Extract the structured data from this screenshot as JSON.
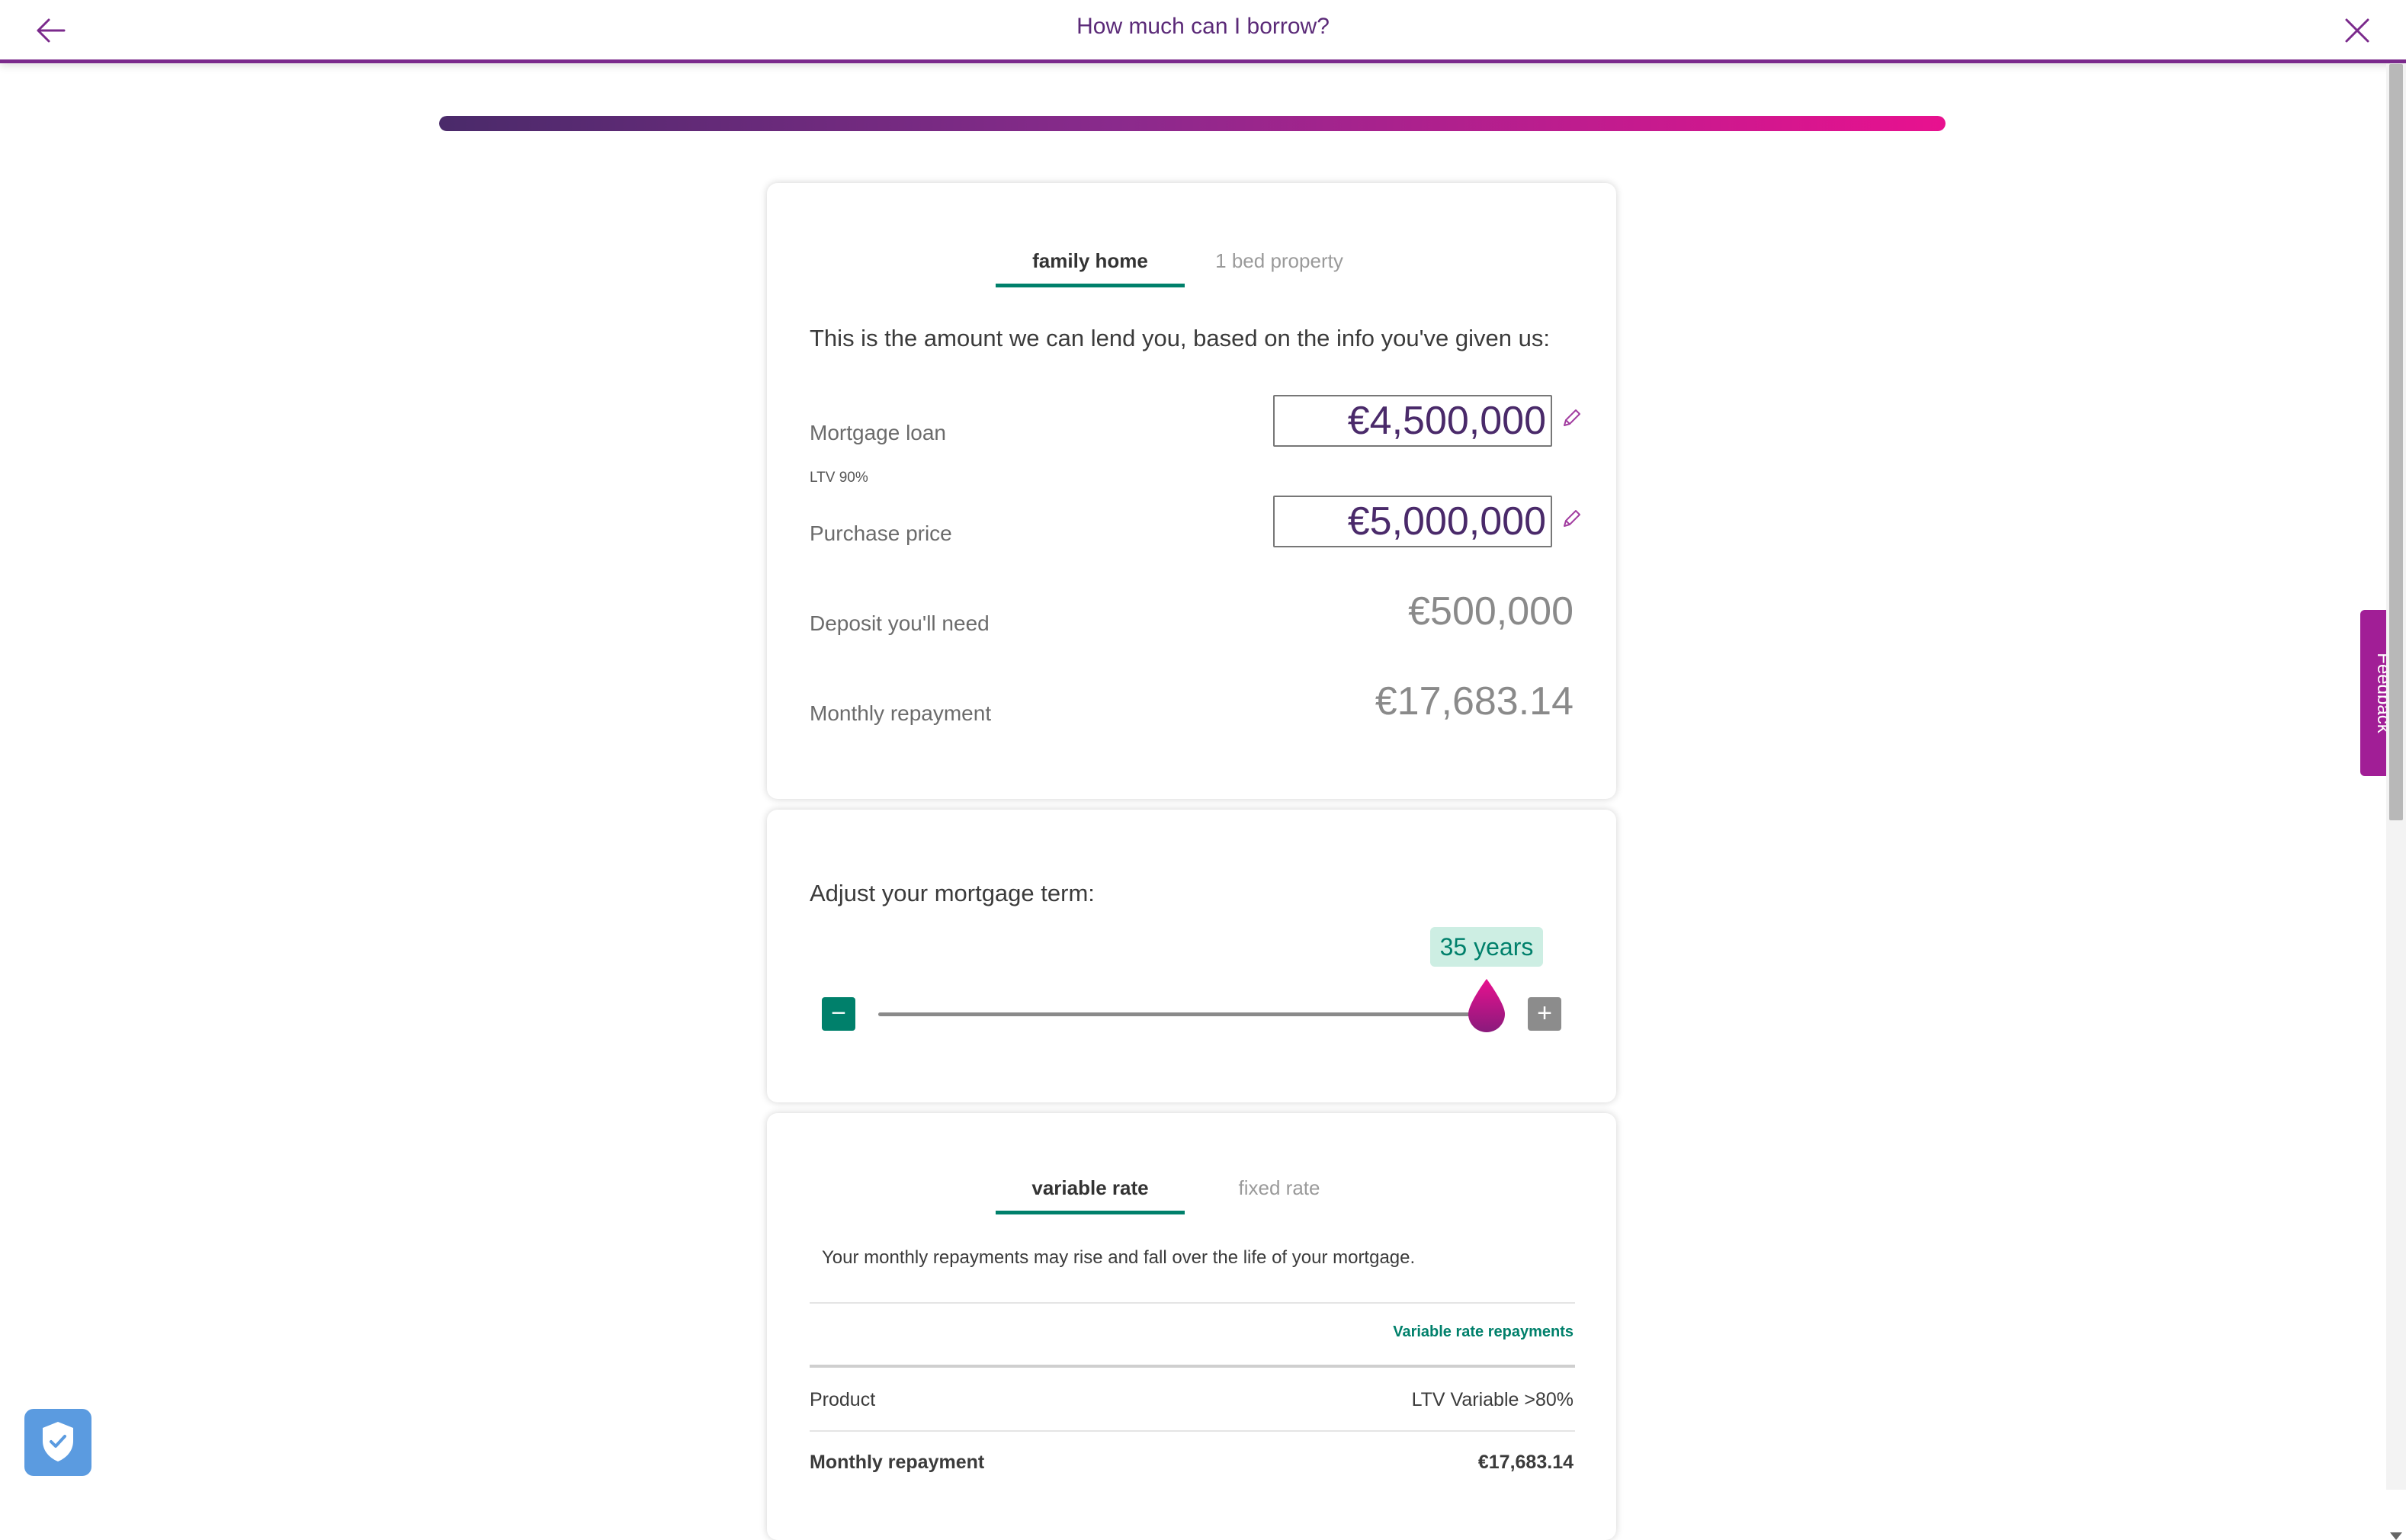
{
  "header": {
    "title": "How much can I borrow?",
    "back_icon": "arrow-left-icon",
    "close_icon": "close-icon",
    "accent": "#7b2a8c"
  },
  "progress": {
    "fraction": 1.0
  },
  "summary_card": {
    "tabs": [
      {
        "label": "family home",
        "active": true
      },
      {
        "label": "1 bed property",
        "active": false
      }
    ],
    "intro": "This is the amount we can lend you, based on the info you've given us:",
    "mortgage_loan": {
      "label": "Mortgage loan",
      "value": "€4,500,000"
    },
    "ltv": "LTV 90%",
    "purchase_price": {
      "label": "Purchase price",
      "value": "€5,000,000"
    },
    "deposit": {
      "label": "Deposit you'll need",
      "value": "€500,000"
    },
    "monthly": {
      "label": "Monthly repayment",
      "value": "€17,683.14"
    }
  },
  "term_card": {
    "heading": "Adjust your mortgage term:",
    "term_label": "35 years",
    "term_years": 35,
    "minus_symbol": "−",
    "plus_symbol": "+",
    "accent": "#00806b"
  },
  "rate_card": {
    "tabs": [
      {
        "label": "variable rate",
        "active": true
      },
      {
        "label": "fixed rate",
        "active": false
      }
    ],
    "description": "Your monthly repayments may rise and fall over the life of your mortgage.",
    "link": "Variable rate repayments",
    "rows": [
      {
        "label": "Product",
        "value": "LTV Variable >80%"
      },
      {
        "label": "Monthly repayment",
        "value": "€17,683.14"
      }
    ]
  },
  "feedback": {
    "label": "Feedback",
    "color": "#a11e96"
  },
  "shield_icon": "shield-check-icon"
}
